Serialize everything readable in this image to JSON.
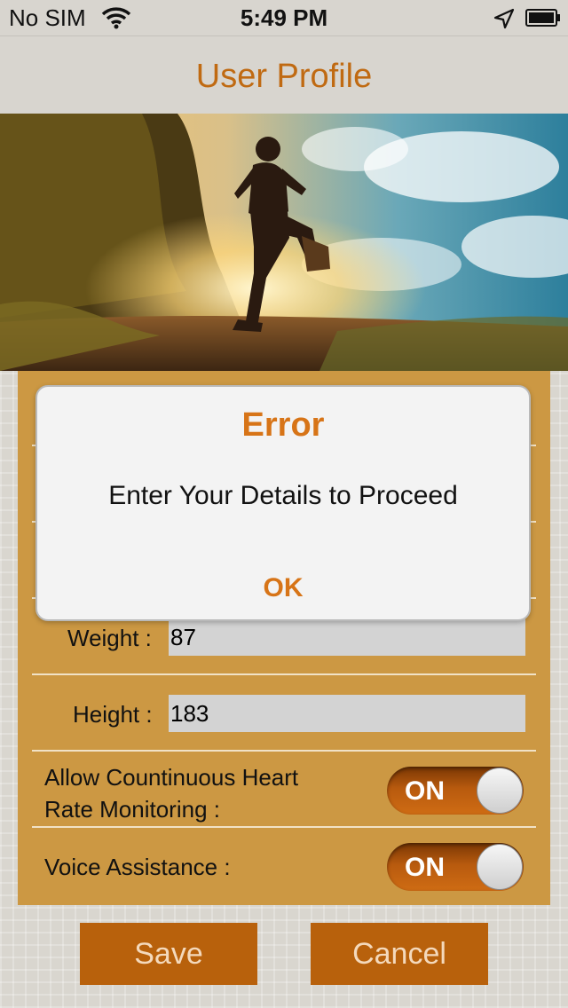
{
  "status_bar": {
    "carrier": "No SIM",
    "time": "5:49 PM"
  },
  "nav": {
    "title": "User Profile"
  },
  "form": {
    "weight": {
      "label": "Weight :",
      "value": "87"
    },
    "height": {
      "label": "Height :",
      "value": "183"
    },
    "heart_rate": {
      "label_line1": "Allow Countinuous Heart",
      "label_line2": "Rate Monitoring :",
      "toggle": "ON",
      "on": true
    },
    "voice": {
      "label": "Voice Assistance :",
      "toggle": "ON",
      "on": true
    }
  },
  "buttons": {
    "save": "Save",
    "cancel": "Cancel"
  },
  "alert": {
    "title": "Error",
    "message": "Enter Your Details to Proceed",
    "ok": "OK"
  },
  "colors": {
    "accent": "#c06a12",
    "panel": "#cc9843",
    "button": "#b8610c",
    "alert_text": "#d77417"
  }
}
